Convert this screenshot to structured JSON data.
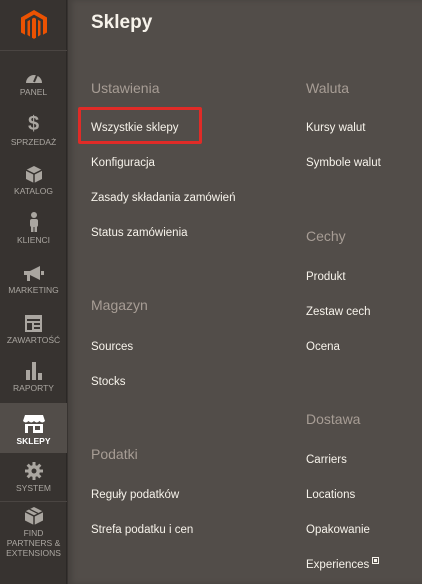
{
  "nav": {
    "items": [
      {
        "label": "PANEL",
        "icon": "dashboard-icon"
      },
      {
        "label": "SPRZEDAŻ",
        "icon": "dollar-icon"
      },
      {
        "label": "KATALOG",
        "icon": "cube-icon"
      },
      {
        "label": "KLIENCI",
        "icon": "person-icon"
      },
      {
        "label": "MARKETING",
        "icon": "megaphone-icon"
      },
      {
        "label": "ZAWARTOŚĆ",
        "icon": "layout-icon"
      },
      {
        "label": "RAPORTY",
        "icon": "bar-chart-icon"
      },
      {
        "label": "SKLEPY",
        "icon": "store-icon"
      },
      {
        "label": "SYSTEM",
        "icon": "gear-icon"
      },
      {
        "label": "FIND PARTNERS & EXTENSIONS",
        "icon": "box-icon"
      }
    ],
    "active": "SKLEPY"
  },
  "panel": {
    "title": "Sklepy",
    "left": {
      "sections": [
        {
          "title": "Ustawienia",
          "links": [
            "Wszystkie sklepy",
            "Konfiguracja",
            "Zasady składania zamówień",
            "Status zamówienia"
          ]
        },
        {
          "title": "Magazyn",
          "links": [
            "Sources",
            "Stocks"
          ]
        },
        {
          "title": "Podatki",
          "links": [
            "Reguły podatków",
            "Strefa podatku i cen"
          ]
        }
      ]
    },
    "right": {
      "sections": [
        {
          "title": "Waluta",
          "links": [
            "Kursy walut",
            "Symbole walut"
          ]
        },
        {
          "title": "Cechy",
          "links": [
            "Produkt",
            "Zestaw cech",
            "Ocena"
          ]
        },
        {
          "title": "Dostawa",
          "links": [
            "Carriers",
            "Locations",
            "Opakowanie",
            "Experiences"
          ]
        }
      ]
    }
  },
  "colors": {
    "nav_bg": "#373330",
    "panel_bg": "#524d49",
    "logo_orange": "#eb5202",
    "highlight_red": "#e02b27"
  }
}
